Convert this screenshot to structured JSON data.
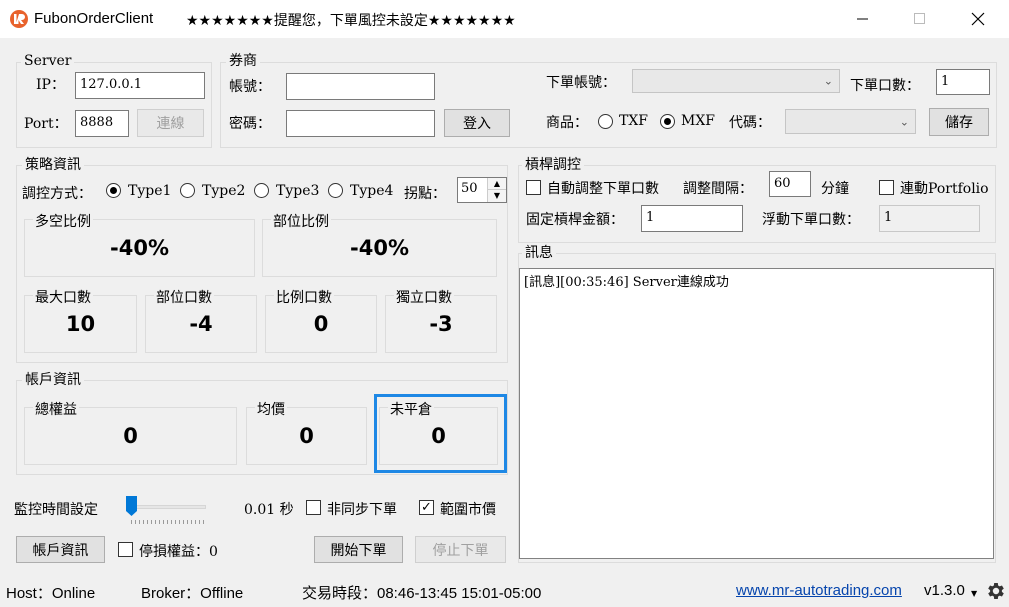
{
  "window": {
    "app_title": "FubonOrderClient",
    "warning": "★★★★★★★提醒您，下單風控未設定★★★★★★★"
  },
  "server": {
    "group_label": "Server",
    "ip_label": "IP：",
    "ip_value": "127.0.0.1",
    "port_label": "Port：",
    "port_value": "8888",
    "connect_label": "連線"
  },
  "broker": {
    "group_label": "券商",
    "account_label": "帳號：",
    "account_value": "",
    "password_label": "密碼：",
    "password_value": "",
    "login_label": "登入",
    "order_account_label": "下單帳號：",
    "order_account_value": "",
    "order_qty_label": "下單口數：",
    "order_qty_value": "1",
    "product_label": "商品：",
    "product_options": [
      "TXF",
      "MXF"
    ],
    "product_selected": "MXF",
    "code_label": "代碼：",
    "code_value": "",
    "save_label": "儲存"
  },
  "strategy": {
    "group_label": "策略資訊",
    "mode_label": "調控方式：",
    "types": [
      "Type1",
      "Type2",
      "Type3",
      "Type4"
    ],
    "type_selected": "Type1",
    "stoppoint_label": "拐點：",
    "stoppoint_value": "50",
    "long_short_label": "多空比例",
    "long_short_value": "-40%",
    "position_ratio_label": "部位比例",
    "position_ratio_value": "-40%",
    "max_qty_label": "最大口數",
    "max_qty_value": "10",
    "position_qty_label": "部位口數",
    "position_qty_value": "-4",
    "ratio_qty_label": "比例口數",
    "ratio_qty_value": "0",
    "independent_qty_label": "獨立口數",
    "independent_qty_value": "-3"
  },
  "leverage": {
    "group_label": "槓桿調控",
    "auto_adjust_label": "自動調整下單口數",
    "auto_adjust_checked": false,
    "interval_label": "調整間隔：",
    "interval_value": "60",
    "interval_unit": "分鐘",
    "link_portfolio_label": "連動Portfolio",
    "link_portfolio_checked": false,
    "fixed_amount_label": "固定槓桿金額：",
    "fixed_amount_value": "1",
    "float_qty_label": "浮動下單口數：",
    "float_qty_value": "1"
  },
  "messages": {
    "group_label": "訊息",
    "lines": [
      "[訊息][00:35:46] Server連線成功"
    ]
  },
  "account": {
    "group_label": "帳戶資訊",
    "equity_label": "總權益",
    "equity_value": "0",
    "avg_price_label": "均價",
    "avg_price_value": "0",
    "open_position_label": "未平倉",
    "open_position_value": "0"
  },
  "controls": {
    "monitor_time_label": "監控時間設定",
    "monitor_time_value": "0.01 秒",
    "async_order_label": "非同步下單",
    "async_order_checked": false,
    "range_market_label": "範圍市價",
    "range_market_checked": true,
    "account_info_button": "帳戶資訊",
    "stop_loss_label": "停損權益：0",
    "stop_loss_checked": false,
    "start_order_button": "開始下單",
    "stop_order_button": "停止下單"
  },
  "status": {
    "host": "Host：Online",
    "broker": "Broker：Offline",
    "session": "交易時段：08:46-13:45 15:01-05:00",
    "link": "www.mr-autotrading.com",
    "version": "v1.3.0"
  },
  "colors": {
    "highlight_border": "#1e88e5",
    "link": "#0645ad",
    "brand_icon": "#e8622c"
  }
}
